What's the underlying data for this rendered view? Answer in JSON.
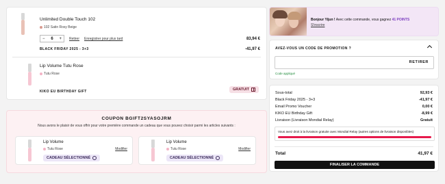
{
  "cart": {
    "items": [
      {
        "name": "Unlimited Double Touch 102",
        "shade": "102 Satin Rosy Beige",
        "shade_color": "#d99a8f",
        "qty": "6",
        "remove": "Retirer",
        "save_later": "Enregistrer pour plus tard",
        "price": "83,94 €",
        "promo_label": "BLACK FRIDAY 2025 - 3+3",
        "promo_value": "-41,97 €"
      },
      {
        "name": "Lip Volume Tutu Rose",
        "shade": "Tutu Rose",
        "shade_color": "#f4b3c5",
        "promo_label": "KIKO EU BIRTHDAY GIFT",
        "gift_badge": "GRATUIT"
      }
    ]
  },
  "coupon": {
    "title": "COUPON BGIFT2SYASOJRM",
    "message": "Nous avons le plaisir de vous offrir pour votre première commande un cadeau que vous pouvez choisir parmi les articles suivants :",
    "options": [
      {
        "name": "Lip Volume",
        "shade": "Tutu Rose",
        "edit": "Modifier",
        "selected": "CADEAU SÉLECTIONNÉ"
      },
      {
        "name": "Lip Volume",
        "shade": "Tutu Rose",
        "edit": "Modifier",
        "selected": "CADEAU SÉLECTIONNÉ"
      }
    ]
  },
  "loyalty": {
    "greeting": "Bonjour Yijun !",
    "text_prefix": "Avec cette commande, vous gagnez",
    "points": "41 POINTS",
    "link": "S'inscrire"
  },
  "promo": {
    "heading": "AVEZ-VOUS UN CODE DE PROMOTION ?",
    "input_value": "",
    "input_placeholder": "",
    "apply": "RETIRER",
    "applied": "Code appliqué"
  },
  "summary": {
    "lines": [
      {
        "label": "Sous-total",
        "value": "92,93 €"
      },
      {
        "label": "Black Friday 2025 - 3+3",
        "value": "-41,97 €"
      },
      {
        "label": "Email Promo Voucher",
        "value": "0,00 €"
      },
      {
        "label": "KIKO EU Birthday Gift",
        "value": "-8,99 €"
      },
      {
        "label": "Livraison (Livraison Mondial Relay)",
        "value": "Gratuit"
      }
    ],
    "shipping_note": "Vous avez droit à la livraison gratuite avec Mondial Relay (autres options de livraison disponibles)",
    "shipping_progress": 1.0,
    "total_label": "Total",
    "total_value": "41,97 €",
    "checkout": "FINALISER LA COMMANDE"
  },
  "colors": {
    "accent": "#e6194b",
    "coupon_bg": "#fdf1f3",
    "chip_bg": "#ece6f7",
    "dark": "#111111"
  }
}
